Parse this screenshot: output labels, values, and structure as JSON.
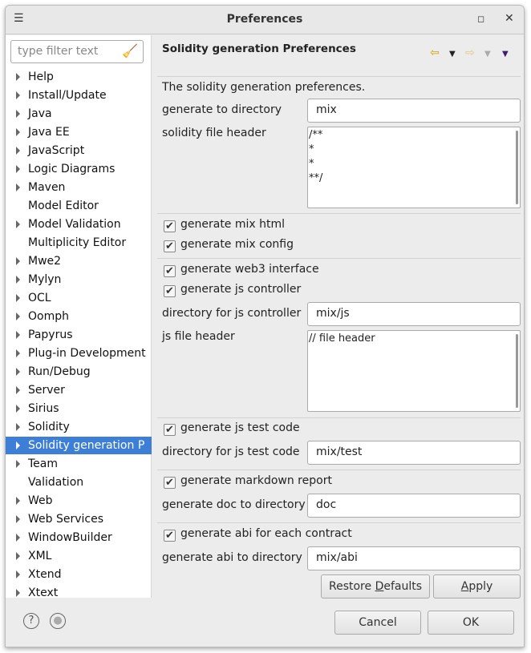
{
  "window": {
    "title": "Preferences",
    "menu_icon": "hamburger-icon",
    "maximize_icon": "maximize-icon",
    "close_icon": "close-icon"
  },
  "sidebar": {
    "filter_placeholder": "type filter text",
    "items": [
      {
        "label": "Help",
        "arrow": true
      },
      {
        "label": "Install/Update",
        "arrow": true
      },
      {
        "label": "Java",
        "arrow": true
      },
      {
        "label": "Java EE",
        "arrow": true
      },
      {
        "label": "JavaScript",
        "arrow": true
      },
      {
        "label": "Logic Diagrams",
        "arrow": true
      },
      {
        "label": "Maven",
        "arrow": true
      },
      {
        "label": "Model Editor",
        "arrow": false
      },
      {
        "label": "Model Validation",
        "arrow": true
      },
      {
        "label": "Multiplicity Editor",
        "arrow": false
      },
      {
        "label": "Mwe2",
        "arrow": true
      },
      {
        "label": "Mylyn",
        "arrow": true
      },
      {
        "label": "OCL",
        "arrow": true
      },
      {
        "label": "Oomph",
        "arrow": true
      },
      {
        "label": "Papyrus",
        "arrow": true
      },
      {
        "label": "Plug-in Development",
        "arrow": true
      },
      {
        "label": "Run/Debug",
        "arrow": true
      },
      {
        "label": "Server",
        "arrow": true
      },
      {
        "label": "Sirius",
        "arrow": true
      },
      {
        "label": "Solidity",
        "arrow": true
      },
      {
        "label": "Solidity generation P",
        "arrow": true,
        "selected": true
      },
      {
        "label": "Team",
        "arrow": true
      },
      {
        "label": "Validation",
        "arrow": false
      },
      {
        "label": "Web",
        "arrow": true
      },
      {
        "label": "Web Services",
        "arrow": true
      },
      {
        "label": "WindowBuilder",
        "arrow": true
      },
      {
        "label": "XML",
        "arrow": true
      },
      {
        "label": "Xtend",
        "arrow": true
      },
      {
        "label": "Xtext",
        "arrow": true
      }
    ]
  },
  "page": {
    "title": "Solidity generation Preferences",
    "description": "The solidity generation preferences.",
    "gen_dir_label": "generate to directory",
    "gen_dir_value": "mix",
    "sol_header_label": "solidity file header",
    "sol_header_value": "/**\n*\n*\n**/",
    "mix_html": "generate mix html",
    "mix_config": "generate mix config",
    "web3": "generate web3 interface",
    "js_controller": "generate js controller",
    "js_dir_label": "directory for js controller",
    "js_dir_value": "mix/js",
    "js_header_label": "js file header",
    "js_header_value": "// file header",
    "js_test": "generate js test code",
    "js_test_dir_label": "directory for js test code",
    "js_test_dir_value": "mix/test",
    "markdown": "generate markdown report",
    "doc_dir_label": "generate doc to directory",
    "doc_dir_value": "doc",
    "abi": "generate abi for each contract",
    "abi_dir_label": "generate abi to directory",
    "abi_dir_value": "mix/abi",
    "restore_pre": "Restore ",
    "restore_u": "D",
    "restore_post": "efaults",
    "apply_u": "A",
    "apply_post": "pply"
  },
  "footer": {
    "cancel": "Cancel",
    "ok": "OK",
    "help_icon": "help-icon",
    "import_icon": "record-icon"
  }
}
